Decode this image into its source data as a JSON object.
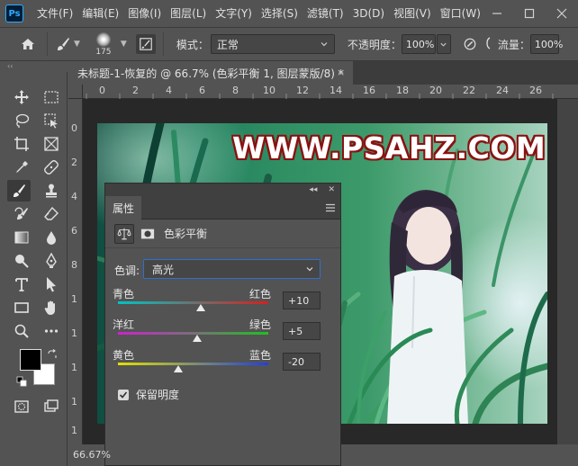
{
  "app": {
    "logo_text": "Ps",
    "menu": [
      "文件(F)",
      "编辑(E)",
      "图像(I)",
      "图层(L)",
      "文字(Y)",
      "选择(S)",
      "滤镜(T)",
      "3D(D)",
      "视图(V)",
      "窗口(W)"
    ]
  },
  "options": {
    "brush_size": "175",
    "mode_label": "模式：",
    "mode_value": "正常",
    "opacity_label": "不透明度：",
    "opacity_value": "100%",
    "flow_label": "流量：",
    "flow_value": "100%"
  },
  "document": {
    "tab_title": "未标题-1-恢复的 @ 66.7% (色彩平衡 1, 图层蒙版/8) *",
    "close_glyph": "×",
    "ruler_top": [
      "0",
      "2",
      "4",
      "6",
      "8",
      "10",
      "12",
      "14",
      "16",
      "18",
      "20",
      "22",
      "24",
      "26"
    ],
    "ruler_left": [
      "0",
      "2",
      "4",
      "6",
      "8",
      "1",
      "1",
      "1",
      "1",
      "1"
    ],
    "watermark_text": "WWW.PSAHZ.COM",
    "zoom": "66.67%"
  },
  "properties": {
    "tab_label": "属性",
    "title": "色彩平衡",
    "tone_label": "色调:",
    "tone_value": "高光",
    "sliders": [
      {
        "left": "青色",
        "right": "红色",
        "value": "+10",
        "level": 10,
        "colors": [
          "#00c4c4",
          "#d52020"
        ]
      },
      {
        "left": "洋红",
        "right": "绿色",
        "value": "+5",
        "level": 5,
        "colors": [
          "#d020d0",
          "#20c020"
        ]
      },
      {
        "left": "黄色",
        "right": "蓝色",
        "value": "-20",
        "level": -20,
        "colors": [
          "#e0e000",
          "#2040e0"
        ]
      }
    ],
    "preserve_label": "保留明度",
    "preserve_checked": true
  },
  "colors": {
    "foreground": "#000000",
    "background": "#ffffff",
    "accent": "#2f6fd6"
  },
  "icons": [
    "home-icon",
    "brush-tool-icon",
    "brush-settings-icon",
    "airbrush-icon",
    "move-tool-icon",
    "marquee-tool-icon",
    "lasso-tool-icon",
    "quick-select-icon",
    "crop-tool-icon",
    "frame-tool-icon",
    "eyedropper-icon",
    "healing-brush-icon",
    "clone-stamp-icon",
    "history-brush-icon",
    "eraser-icon",
    "gradient-icon",
    "blur-icon",
    "dodge-icon",
    "pen-tool-icon",
    "type-tool-icon",
    "path-select-icon",
    "rectangle-tool-icon",
    "hand-tool-icon",
    "zoom-tool-icon",
    "more-icon",
    "swap-colors-icon",
    "quick-mask-icon",
    "screen-mode-icon"
  ]
}
